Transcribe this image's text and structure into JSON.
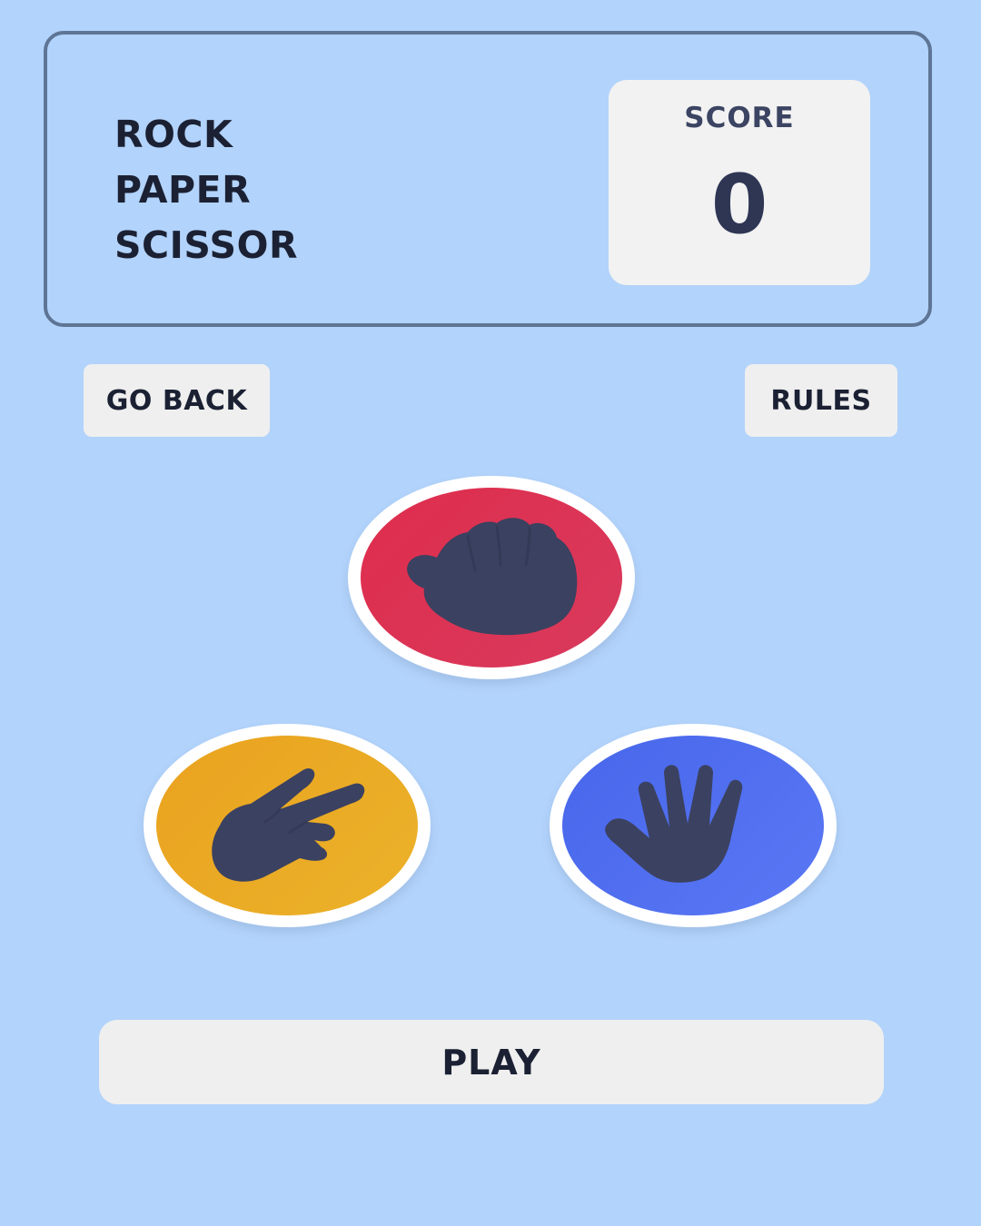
{
  "header": {
    "title_lines": [
      "ROCK",
      "PAPER",
      "SCISSOR"
    ],
    "score_label": "SCORE",
    "score_value": "0"
  },
  "nav": {
    "back_label": "GO BACK",
    "rules_label": "RULES"
  },
  "choices": [
    {
      "id": "rock",
      "icon": "fist-icon",
      "color": "#dc2f51"
    },
    {
      "id": "scissors",
      "icon": "peace-sign-hand-icon",
      "color": "#eba61f"
    },
    {
      "id": "paper",
      "icon": "open-hand-icon",
      "color": "#4e6cf2"
    }
  ],
  "play": {
    "label": "PLAY"
  },
  "colors": {
    "background": "#b2d3fb",
    "header_border": "#5e7595",
    "button_bg": "#efefef",
    "icon_fill": "#3b4160"
  }
}
